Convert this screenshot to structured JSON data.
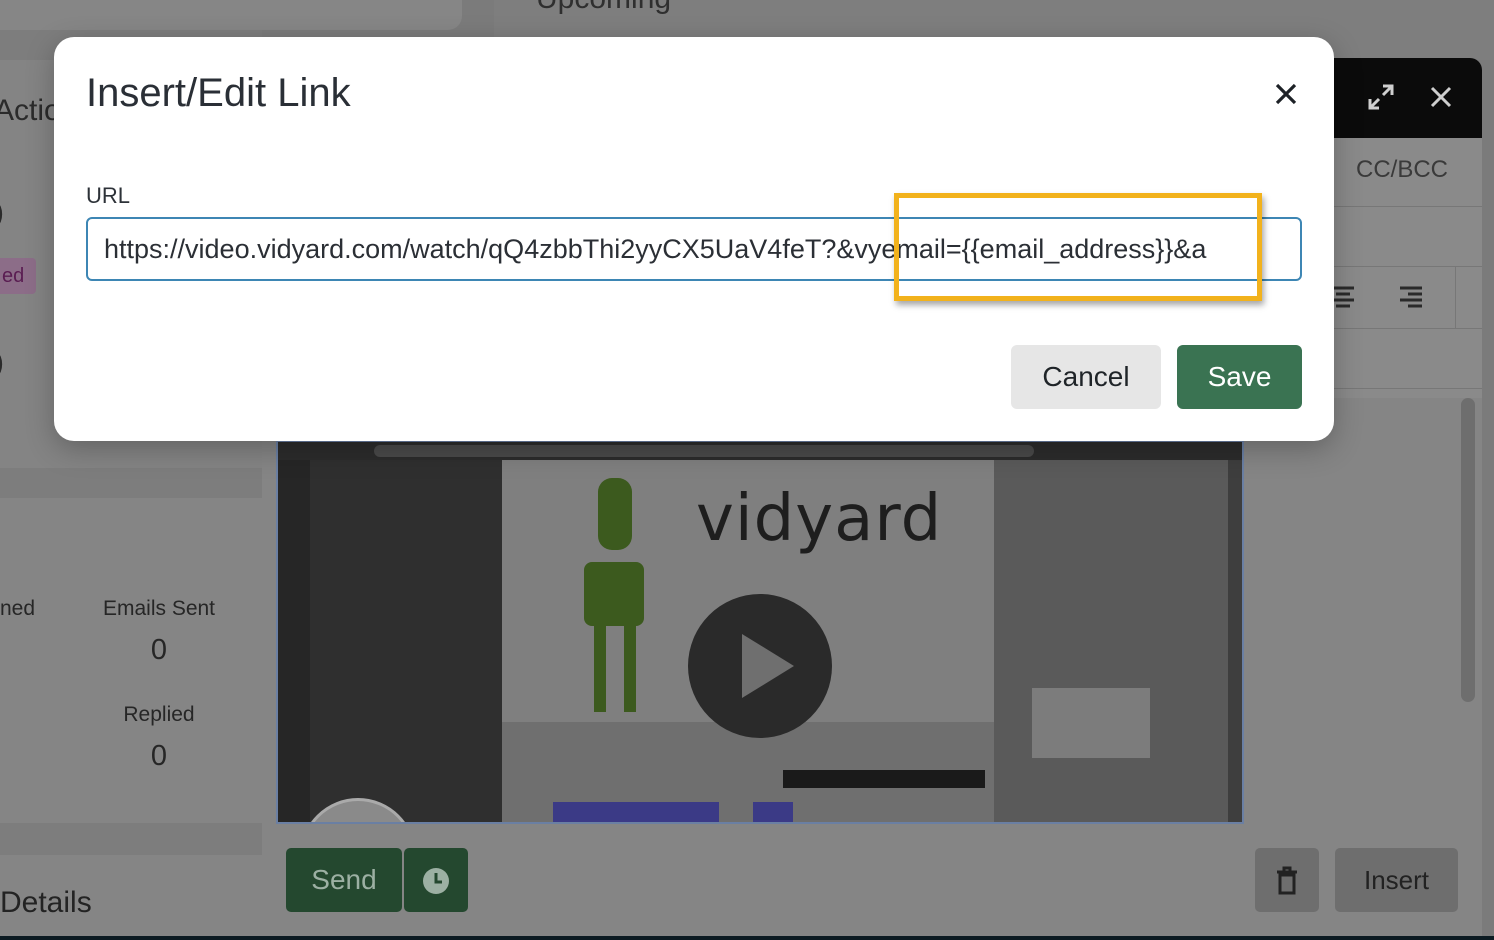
{
  "background": {
    "upcoming_title": "Upcoming",
    "actions_label": "Actio",
    "paren_1": ")",
    "paren_2": ")",
    "status_badge": "ed",
    "stats": {
      "opened_label": "ned",
      "emails_sent_label": "Emails Sent",
      "emails_sent_value": "0",
      "replied_label": "Replied",
      "replied_value": "0"
    },
    "details_label": "Details"
  },
  "composer": {
    "cc_bcc": "CC/BCC",
    "send_label": "Send",
    "insert_label": "Insert",
    "video_logo": "vidyard"
  },
  "modal": {
    "title": "Insert/Edit Link",
    "url_label": "URL",
    "url_value": "https://video.vidyard.com/watch/qQ4zbbThi2yyCX5UaV4feT?&vyemail={{email_address}}&a",
    "cancel_label": "Cancel",
    "save_label": "Save"
  },
  "icons": {
    "close": "close-icon",
    "expand": "expand-icon",
    "clock": "clock-icon",
    "trash": "trash-icon",
    "play": "play-icon"
  },
  "colors": {
    "save_green": "#3a7352",
    "highlight_yellow": "#f2b21c",
    "input_border": "#3d86b4",
    "cancel_gray": "#e6e6e6"
  }
}
